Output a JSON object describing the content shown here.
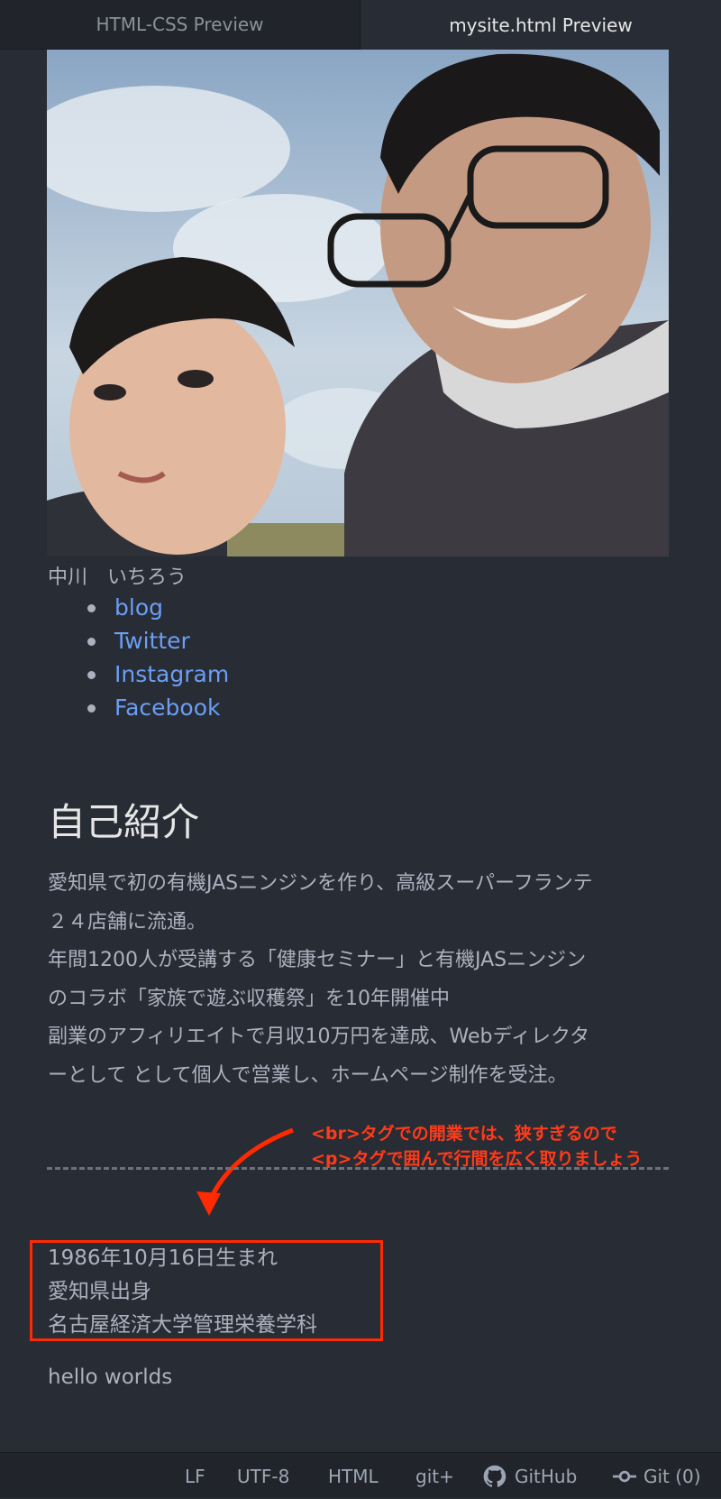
{
  "tabs": [
    {
      "label": "HTML-CSS Preview",
      "active": false
    },
    {
      "label": "mysite.html Preview",
      "active": true
    }
  ],
  "profile": {
    "name": "中川　いちろう",
    "links": [
      "blog",
      "Twitter",
      "Instagram",
      "Facebook"
    ]
  },
  "intro": {
    "heading": "自己紹介",
    "lines": [
      "愛知県で初の有機JASニンジンを作り、高級スーパーフランテ",
      "２４店舗に流通。",
      "年間1200人が受講する「健康セミナー」と有機JASニンジン",
      "のコラボ「家族で遊ぶ収穫祭」を10年開催中",
      "副業のアフィリエイトで月収10万円を達成、Webディレクタ",
      "ーとして として個人で営業し、ホームページ制作を受注。"
    ]
  },
  "annotation": {
    "line1": "<br>タグでの開業では、狭すぎるので",
    "line2": "<p>タグで囲んで行間を広く取りましょう",
    "color": "#ff3b1a"
  },
  "bio": [
    "1986年10月16日生まれ",
    "愛知県出身",
    "名古屋経済大学管理栄養学科"
  ],
  "footer_text": "hello worlds",
  "statusbar": {
    "line_ending": "LF",
    "encoding": "UTF-8",
    "grammar": "HTML",
    "git_plus": "git+",
    "github": "GitHub",
    "git": "Git (0)"
  },
  "colors": {
    "background": "#282c34",
    "link": "#6b9ef5",
    "text": "#abb2bf",
    "highlight_box": "#ff2a00"
  }
}
